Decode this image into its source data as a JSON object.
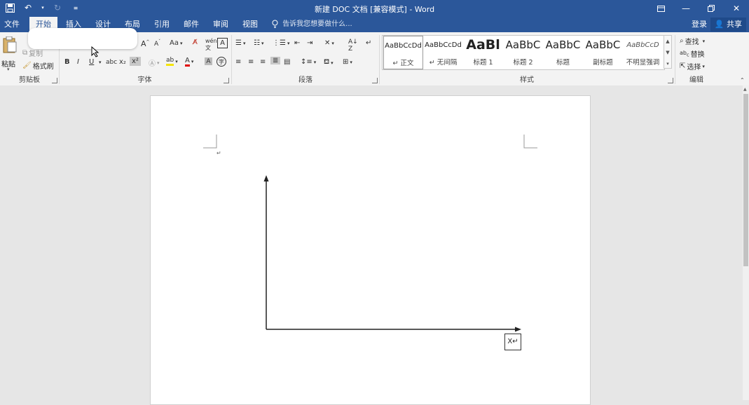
{
  "titlebar": {
    "title": "新建 DOC 文档 [兼容模式] - Word"
  },
  "tabs": {
    "file": "文件",
    "home": "开始",
    "insert": "插入",
    "design": "设计",
    "layout": "布局",
    "references": "引用",
    "mailings": "邮件",
    "review": "审阅",
    "view": "视图",
    "tell_me": "告诉我您想要做什么...",
    "login": "登录",
    "share": "共享"
  },
  "clipboard": {
    "paste": "粘贴",
    "copy": "复制",
    "format_painter": "格式刷",
    "label": "剪贴板"
  },
  "font": {
    "label": "字体",
    "aa": "Aa",
    "bold": "B",
    "italic": "I",
    "underline": "U",
    "strike": "abc",
    "subscript": "x₂",
    "superscript": "x²"
  },
  "paragraph": {
    "label": "段落"
  },
  "styles": {
    "label": "样式",
    "items": [
      {
        "preview": "AaBbCcDd",
        "name": "↵ 正文"
      },
      {
        "preview": "AaBbCcDd",
        "name": "↵ 无间隔"
      },
      {
        "preview": "AaBl",
        "name": "标题 1"
      },
      {
        "preview": "AaBbC",
        "name": "标题 2"
      },
      {
        "preview": "AaBbC",
        "name": "标题"
      },
      {
        "preview": "AaBbC",
        "name": "副标题"
      },
      {
        "preview": "AaBbCcD",
        "name": "不明显强调"
      }
    ]
  },
  "editing": {
    "find": "查找",
    "replace": "替换",
    "select": "选择",
    "label": "编辑"
  },
  "document": {
    "x_label": "X↵",
    "para_mark": "↵"
  },
  "colors": {
    "brand": "#2b579a",
    "ribbon": "#f3f3f3",
    "canvas": "#e6e6e6"
  }
}
